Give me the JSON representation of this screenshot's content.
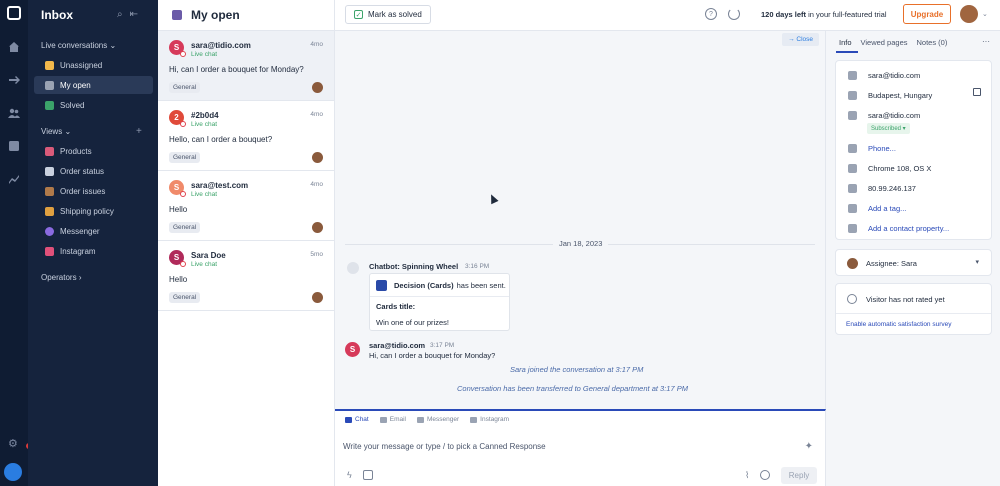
{
  "sidebar": {
    "title": "Inbox",
    "live_conversations": "Live conversations",
    "items": [
      {
        "label": "Unassigned",
        "color": "#f2b84b"
      },
      {
        "label": "My open",
        "color": "#9aa3b3"
      },
      {
        "label": "Solved",
        "color": "#3ba36a"
      }
    ],
    "views_label": "Views",
    "views": [
      {
        "label": "Products",
        "color": "#d95a7a"
      },
      {
        "label": "Order status",
        "color": "#c9d1df"
      },
      {
        "label": "Order issues",
        "color": "#b07a4a"
      },
      {
        "label": "Shipping policy",
        "color": "#e0a040"
      },
      {
        "label": "Messenger",
        "color": "#8a6ae0"
      },
      {
        "label": "Instagram",
        "color": "#e0507a"
      }
    ],
    "operators_label": "Operators"
  },
  "list": {
    "title": "My open",
    "conversations": [
      {
        "initial": "S",
        "name": "sara@tidio.com",
        "channel": "Live chat",
        "time": "4mo",
        "message": "Hi, can I order a bouquet for Monday?",
        "tag": "General",
        "avatar_color": "#d63a5a"
      },
      {
        "initial": "2",
        "name": "#2b0d4",
        "channel": "Live chat",
        "time": "4mo",
        "message": "Hello, can I order a bouquet?",
        "tag": "General",
        "avatar_color": "#e04a3a"
      },
      {
        "initial": "S",
        "name": "sara@test.com",
        "channel": "Live chat",
        "time": "4mo",
        "message": "Hello",
        "tag": "General",
        "avatar_color": "#f08a6a"
      },
      {
        "initial": "S",
        "name": "Sara Doe",
        "channel": "Live chat",
        "time": "5mo",
        "message": "Hello",
        "tag": "General",
        "avatar_color": "#b02a5a"
      }
    ]
  },
  "topbar": {
    "mark_solved": "Mark as solved",
    "help": "?",
    "trial_days": "120 days left",
    "trial_rest": " in your full-featured trial",
    "upgrade": "Upgrade"
  },
  "chat": {
    "close": "Close",
    "date": "Jan 18, 2023",
    "bot_name": "Chatbot: Spinning Wheel",
    "bot_time": "3:16 PM",
    "card_title_bold": "Decision (Cards)",
    "card_title_rest": "has been sent.",
    "card_label": "Cards title:",
    "card_value": "Win one of our prizes!",
    "user_initial": "S",
    "user_name": "sara@tidio.com",
    "user_time": "3:17 PM",
    "user_message": "Hi, can I order a bouquet for Monday?",
    "system_1": "Sara joined the conversation at 3:17 PM",
    "system_2": "Conversation has been transferred to General department at 3:17 PM"
  },
  "composer": {
    "tabs": [
      "Chat",
      "Email",
      "Messenger",
      "Instagram"
    ],
    "placeholder": "Write your message or type / to pick a Canned Response",
    "reply": "Reply"
  },
  "panel": {
    "tabs": [
      "Info",
      "Viewed pages",
      "Notes (0)"
    ],
    "rows": [
      {
        "text": "sara@tidio.com",
        "icon": "user-icon"
      },
      {
        "text": "Budapest, Hungary",
        "icon": "location-icon"
      },
      {
        "text": "sara@tidio.com",
        "icon": "mail-icon"
      },
      {
        "text": "Phone...",
        "icon": "phone-icon"
      },
      {
        "text": "Chrome 108, OS X",
        "icon": "laptop-icon"
      },
      {
        "text": "80.99.246.137",
        "icon": "target-icon"
      },
      {
        "text": "Add a tag...",
        "icon": "tag-icon"
      },
      {
        "text": "Add a contact property...",
        "icon": "folder-icon"
      }
    ],
    "subscribed": "Subscribed ▾",
    "assignee": "Assignee: Sara",
    "rating": "Visitor has not rated yet",
    "rating_link": "Enable automatic satisfaction survey"
  }
}
